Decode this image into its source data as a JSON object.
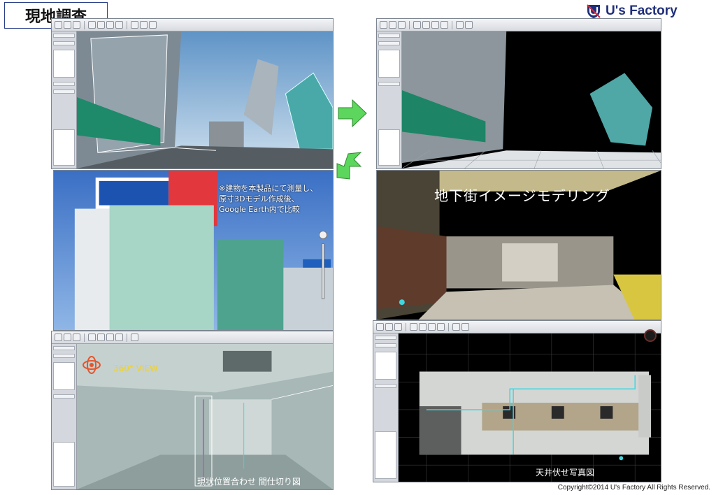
{
  "header": {
    "title": "現地調査",
    "brand": "U's Factory"
  },
  "panels": {
    "street_scan": {},
    "scan_black_bg": {},
    "building_photo": {
      "note": "※建物を本製品にて測量し、原寸3Dモデル作成後、Google Earth内で比較"
    },
    "underground": {
      "label": "地下街イメージモデリング"
    },
    "interior_360": {
      "badge": "360° VIEW",
      "caption": "現状位置合わせ 間仕切り図"
    },
    "ceiling_plan": {
      "caption": "天井伏せ写真図"
    }
  },
  "footer": {
    "copyright": "Copyright©2014 U's Factory All Rights Reserved."
  },
  "colors": {
    "brand_navy": "#1f2f7a",
    "arrow_green": "#5cd65c",
    "cyan_line": "#3fd6e0"
  }
}
